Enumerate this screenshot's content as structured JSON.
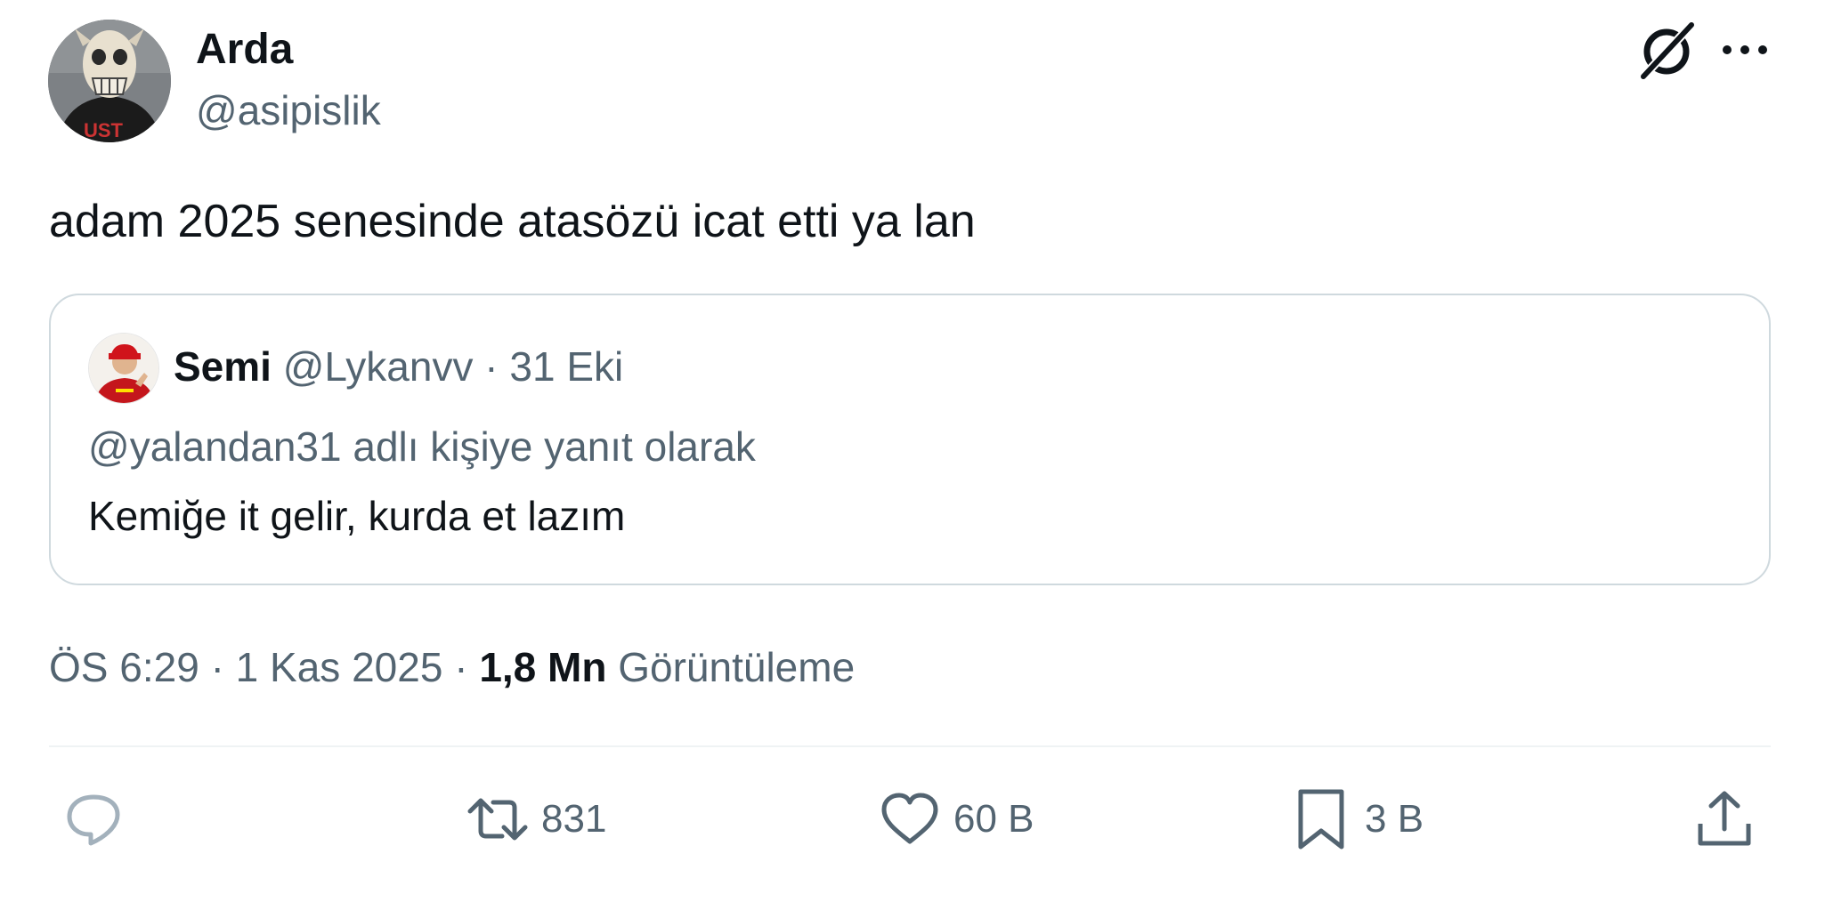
{
  "author": {
    "name": "Arda",
    "handle": "@asipislik",
    "avatar_icon": "masked-person-avatar"
  },
  "header_icons": {
    "grok": "grok-icon",
    "more": "more-icon"
  },
  "tweet": {
    "text": "adam 2025 senesinde atasözü icat etti ya lan"
  },
  "quoted_tweet": {
    "name": "Semi",
    "handle": "@Lykanvv",
    "separator": "·",
    "date": "31 Eki",
    "reply_context": "@yalandan31 adlı kişiye yanıt olarak",
    "text": "Kemiğe it gelir, kurda et lazım"
  },
  "meta": {
    "time": "ÖS 6:29",
    "separator": "·",
    "date": "1 Kas 2025",
    "views_count": "1,8 Mn",
    "views_label": "Görüntüleme"
  },
  "actions": {
    "reply_count": "",
    "retweet_count": "831",
    "like_count": "60 B",
    "bookmark_count": "3 B"
  },
  "colors": {
    "text_primary": "#0f1419",
    "text_secondary": "#536471",
    "border": "#cfd9de",
    "divider": "#eff3f4"
  }
}
